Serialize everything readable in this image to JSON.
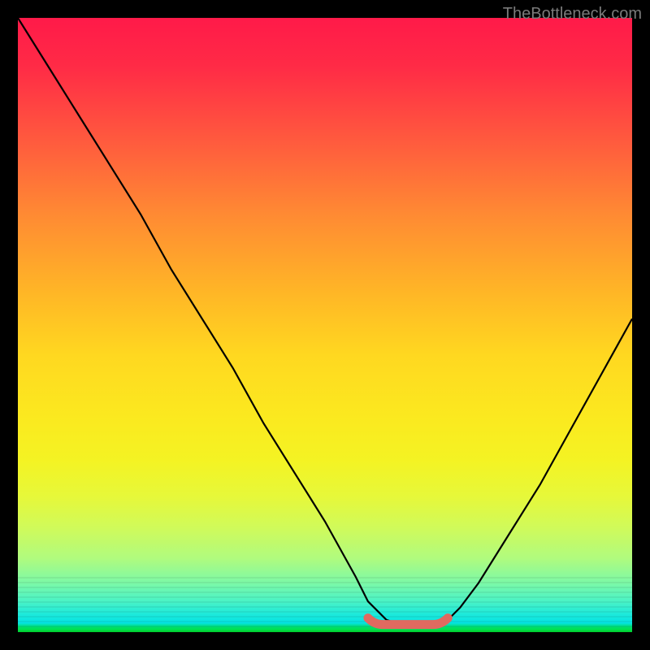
{
  "watermark": "TheBottleneck.com",
  "chart_data": {
    "type": "line",
    "title": "",
    "xlabel": "",
    "ylabel": "",
    "xlim": [
      0,
      100
    ],
    "ylim": [
      0,
      100
    ],
    "grid": false,
    "legend": false,
    "series": [
      {
        "name": "curve",
        "x": [
          0,
          5,
          10,
          15,
          20,
          25,
          30,
          35,
          40,
          45,
          50,
          55,
          57,
          60,
          63,
          65,
          68,
          70,
          72,
          75,
          80,
          85,
          90,
          95,
          100
        ],
        "y": [
          100,
          92,
          84,
          76,
          68,
          59,
          51,
          43,
          34,
          26,
          18,
          9,
          5,
          2,
          1,
          1,
          1,
          2,
          4,
          8,
          16,
          24,
          33,
          42,
          51
        ]
      }
    ],
    "annotations": [
      {
        "name": "valley-marker",
        "x_start": 57,
        "x_end": 70,
        "y": 1.5,
        "color": "#e06a60"
      }
    ],
    "background_gradient_stops": [
      {
        "pos": 0,
        "color": "#ff1a49"
      },
      {
        "pos": 50,
        "color": "#ffd820"
      },
      {
        "pos": 100,
        "color": "#00df2f"
      }
    ]
  }
}
